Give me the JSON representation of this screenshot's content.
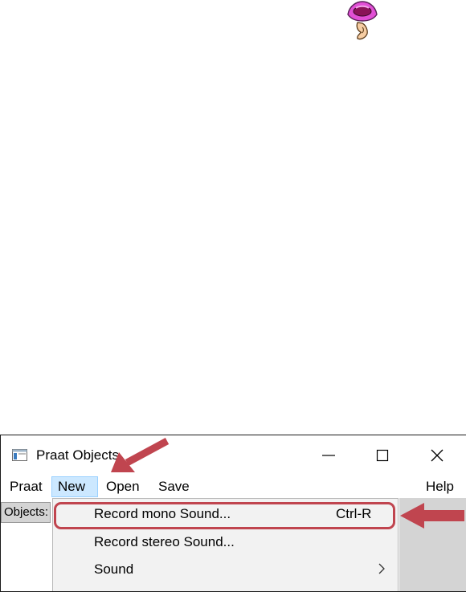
{
  "logo": {
    "icon": "praat-mouth-ear-logo-icon"
  },
  "window": {
    "title": "Praat Objects",
    "icon": "praat-app-icon",
    "controls": {
      "minimize": "minimize-icon",
      "maximize": "maximize-icon",
      "close": "close-icon"
    }
  },
  "menubar": {
    "items": [
      {
        "label": "Praat"
      },
      {
        "label": "New",
        "active": true
      },
      {
        "label": "Open"
      },
      {
        "label": "Save"
      },
      {
        "label": "Help"
      }
    ]
  },
  "objects_label": "Objects:",
  "dropdown": {
    "items": [
      {
        "label": "Record mono Sound...",
        "shortcut": "Ctrl-R",
        "highlighted": true
      },
      {
        "label": "Record stereo Sound...",
        "shortcut": ""
      },
      {
        "label": "Sound",
        "submenu_icon": "chevron-right-icon"
      }
    ]
  },
  "annotations": {
    "arrow_color": "#c0454f"
  }
}
